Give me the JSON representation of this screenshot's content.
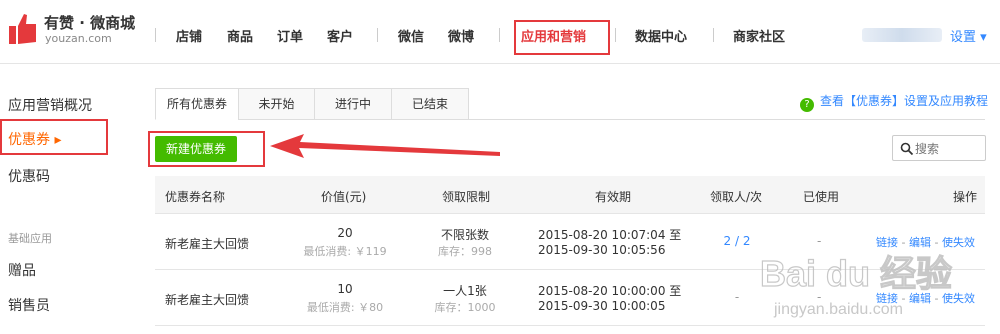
{
  "header": {
    "logo_title": "有赞 · 微商城",
    "logo_sub": "youzan.com",
    "nav": [
      "店铺",
      "商品",
      "订单",
      "客户",
      "微信",
      "微博",
      "应用和营销",
      "数据中心",
      "商家社区"
    ],
    "active_nav": "应用和营销",
    "settings": "设置 ▾",
    "accent": "#e4393c"
  },
  "sidebar": {
    "items": [
      "应用营销概况",
      "优惠券 ▸",
      "优惠码"
    ],
    "group_label": "基础应用",
    "group_items": [
      "赠品",
      "销售员"
    ]
  },
  "tabs": [
    "所有优惠券",
    "未开始",
    "进行中",
    "已结束"
  ],
  "help": {
    "icon": "?",
    "text": "查看【优惠券】设置及应用教程"
  },
  "new_button": "新建优惠券",
  "search": {
    "placeholder": "搜索"
  },
  "table": {
    "headers": [
      "优惠券名称",
      "价值(元)",
      "领取限制",
      "有效期",
      "领取人/次",
      "已使用",
      "操作"
    ],
    "rows": [
      {
        "name": "新老雇主大回馈",
        "value": "20",
        "min_spend": "最低消费: ￥119",
        "limit": "不限张数",
        "stock": "库存：998",
        "valid_from": "2015-08-20 10:07:04 至",
        "valid_to": "2015-09-30 10:05:56",
        "received": "2 / 2",
        "used": "-",
        "actions": [
          "链接",
          "编辑",
          "使失效"
        ]
      },
      {
        "name": "新老雇主大回馈",
        "value": "10",
        "min_spend": "最低消费: ￥80",
        "limit": "一人1张",
        "stock": "库存：1000",
        "valid_from": "2015-08-20 10:00:00 至",
        "valid_to": "2015-09-30 10:00:05",
        "received": "-",
        "used": "-",
        "actions": [
          "链接",
          "编辑",
          "使失效"
        ]
      }
    ],
    "action_separator": "-"
  },
  "watermark": {
    "brand": "Bai du 经验",
    "url": "jingyan.baidu.com"
  }
}
